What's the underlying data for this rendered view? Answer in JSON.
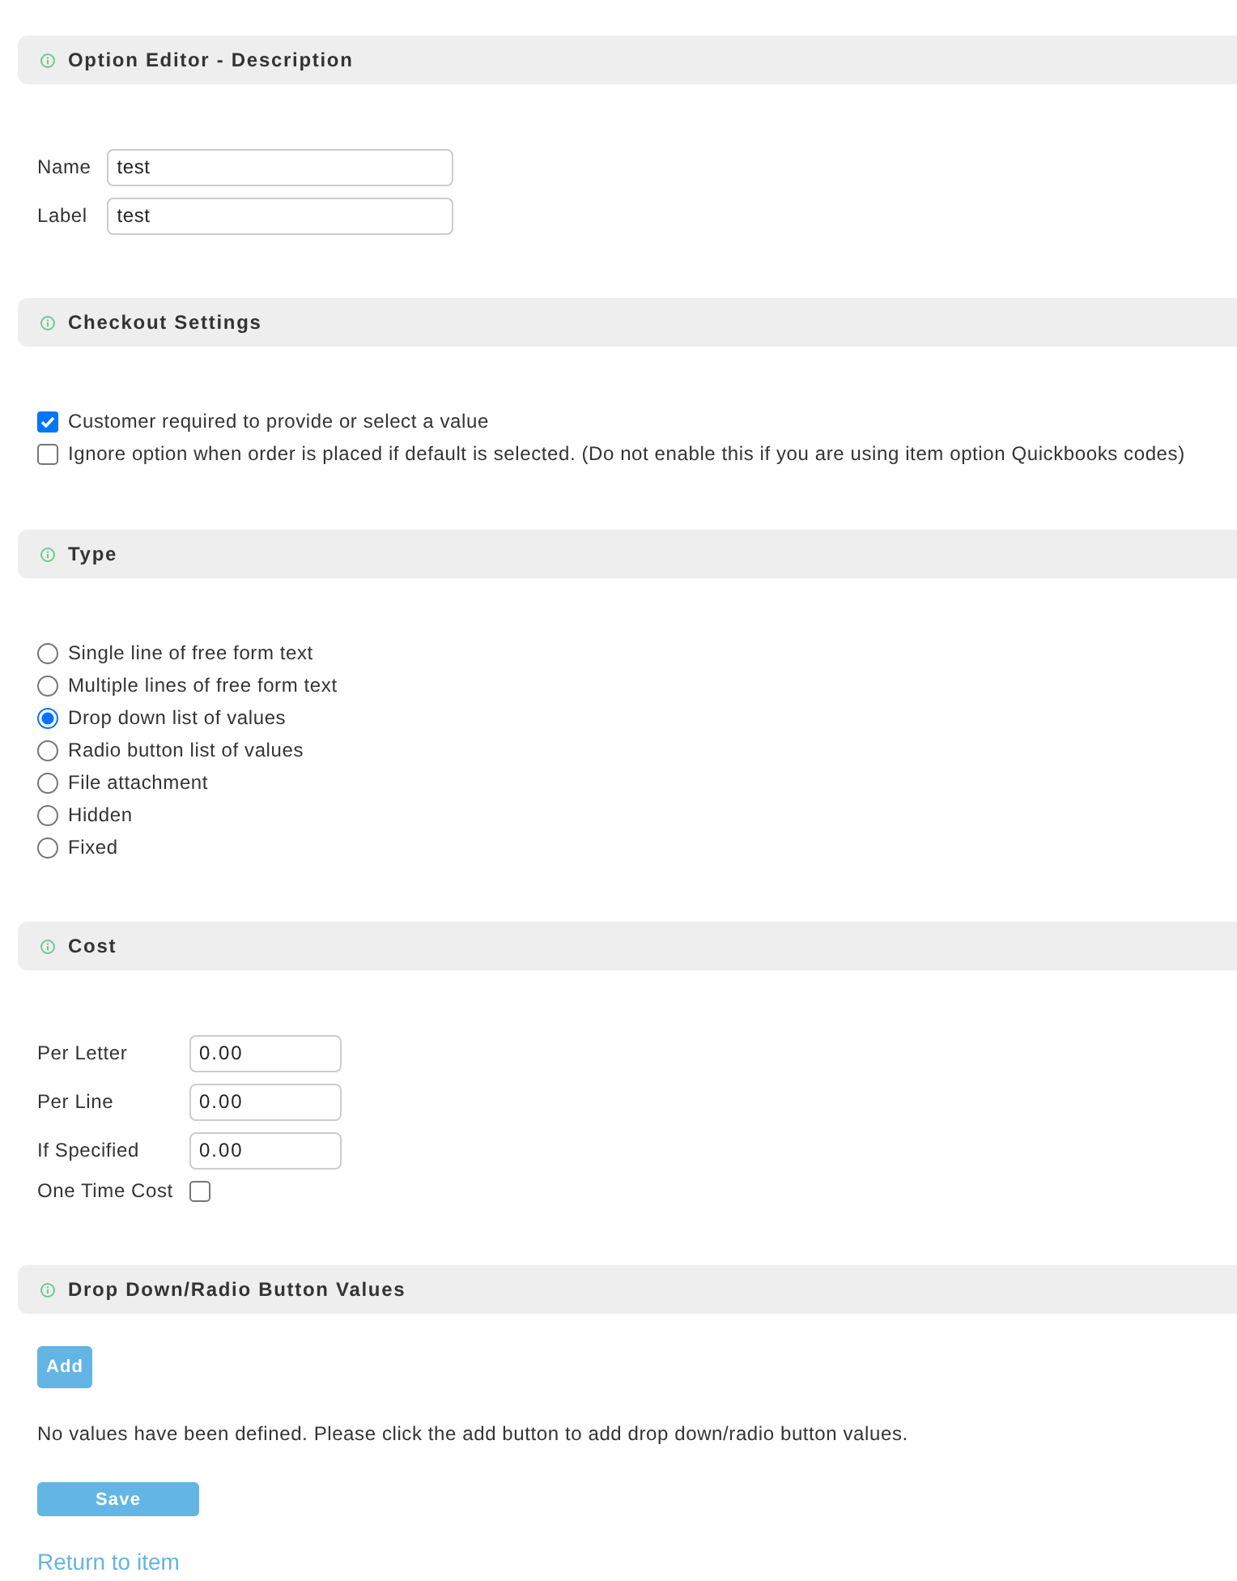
{
  "sections": [
    {
      "kind": "fields",
      "title": "Option Editor - Description",
      "fields": [
        {
          "kind": "text",
          "label": "Name",
          "value": "test"
        },
        {
          "kind": "text",
          "label": "Label",
          "value": "test"
        }
      ]
    },
    {
      "kind": "checkboxes",
      "title": "Checkout Settings",
      "options": [
        {
          "label": "Customer required to provide or select a value",
          "checked": true
        },
        {
          "label": "Ignore option when order is placed if default is selected. (Do not enable this if you are using item option Quickbooks codes)",
          "checked": false
        }
      ]
    },
    {
      "kind": "radios",
      "title": "Type",
      "choices": [
        {
          "label": "Single line of free form text",
          "selected": false
        },
        {
          "label": "Multiple lines of free form text",
          "selected": false
        },
        {
          "label": "Drop down list of values",
          "selected": true
        },
        {
          "label": "Radio button list of values",
          "selected": false
        },
        {
          "label": "File attachment",
          "selected": false
        },
        {
          "label": "Hidden",
          "selected": false
        },
        {
          "label": "Fixed",
          "selected": false
        }
      ]
    },
    {
      "kind": "fields",
      "title": "Cost",
      "fields": [
        {
          "kind": "amount",
          "label": "Per Letter",
          "value": "0.00"
        },
        {
          "kind": "amount",
          "label": "Per Line",
          "value": "0.00"
        },
        {
          "kind": "amount",
          "label": "If Specified",
          "value": "0.00"
        },
        {
          "kind": "checkbox",
          "label": "One Time Cost",
          "checked": false
        }
      ]
    },
    {
      "kind": "values",
      "title": "Drop Down/Radio Button Values",
      "add_button": "Add",
      "message": "No values have been defined. Please click the add button to add drop down/radio button values."
    }
  ],
  "save_button": "Save",
  "return_link": "Return to item"
}
